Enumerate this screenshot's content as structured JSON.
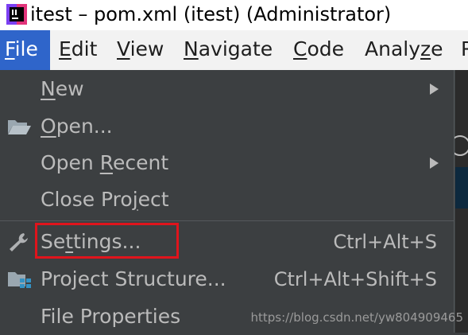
{
  "window": {
    "title": "itest – pom.xml (itest) (Administrator)"
  },
  "menubar": [
    {
      "label": "File",
      "mnemonic": "F",
      "rest": "ile"
    },
    {
      "label": "Edit",
      "mnemonic": "E",
      "rest": "dit"
    },
    {
      "label": "View",
      "mnemonic": "V",
      "rest": "iew"
    },
    {
      "label": "Navigate",
      "mnemonic": "N",
      "rest": "avigate"
    },
    {
      "label": "Code",
      "mnemonic": "C",
      "rest": "ode"
    },
    {
      "label": "Analyze",
      "pre": "Analy",
      "mnemonic": "z",
      "rest": "e"
    },
    {
      "label": "R"
    }
  ],
  "file_menu": [
    {
      "label": "New",
      "mnemonic": "N",
      "rest": "ew",
      "submenu": true
    },
    {
      "label": "Open...",
      "mnemonic": "O",
      "rest": "pen...",
      "icon": "folder-icon"
    },
    {
      "label": "Open Recent",
      "pre": "Open ",
      "mnemonic": "R",
      "rest": "ecent",
      "submenu": true
    },
    {
      "label": "Close Project",
      "pre": "Close Pro",
      "mnemonic": "j",
      "rest": "ect"
    },
    {
      "label": "Settings...",
      "pre": "Se",
      "mnemonic": "t",
      "rest": "tings...",
      "shortcut": "Ctrl+Alt+S",
      "icon": "wrench-icon"
    },
    {
      "label": "Project Structure...",
      "shortcut": "Ctrl+Alt+Shift+S",
      "icon": "project-structure-icon"
    },
    {
      "label": "File Properties"
    }
  ],
  "watermark": "https://blog.csdn.net/yw804909465",
  "colors": {
    "menu_bg": "#3c3f41",
    "menu_text": "#bbbbbb",
    "active_menu": "#2f65ca",
    "highlight": "#e0141c"
  }
}
